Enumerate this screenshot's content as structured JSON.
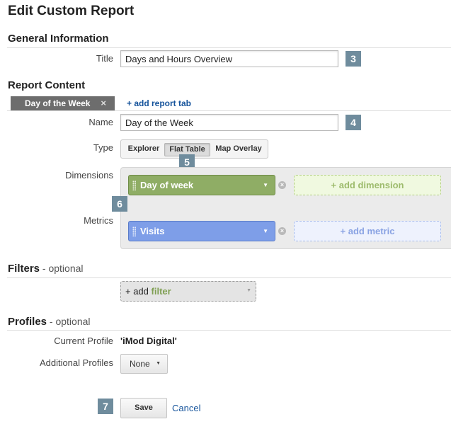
{
  "page": {
    "title": "Edit Custom Report"
  },
  "general": {
    "heading": "General Information",
    "title_label": "Title",
    "title_value": "Days and Hours Overview",
    "badge": "3"
  },
  "report_content": {
    "heading": "Report Content",
    "active_tab": "Day of the Week",
    "tab_close": "×",
    "add_tab": "+ add report tab",
    "name_label": "Name",
    "name_value": "Day of the Week",
    "name_badge": "4",
    "type_label": "Type",
    "type_options": [
      "Explorer",
      "Flat Table",
      "Map Overlay"
    ],
    "type_selected": "Flat Table",
    "type_badge": "5",
    "dimensions_label": "Dimensions",
    "dimension_value": "Day of week",
    "add_dimension": "+ add dimension",
    "metrics_label": "Metrics",
    "metric_value": "Visits",
    "add_metric": "+ add metric",
    "panel_badge": "6",
    "dimension_color": "#8fad65",
    "metric_color": "#7e9ee8"
  },
  "filters": {
    "heading": "Filters",
    "optional": " - optional",
    "add_prefix": "+ add",
    "add_word": "filter"
  },
  "profiles": {
    "heading": "Profiles",
    "optional": " - optional",
    "current_label": "Current Profile",
    "current_value": "'iMod Digital'",
    "additional_label": "Additional Profiles",
    "additional_value": "None"
  },
  "footer": {
    "badge": "7",
    "save_label": "Save",
    "cancel_label": "Cancel"
  }
}
